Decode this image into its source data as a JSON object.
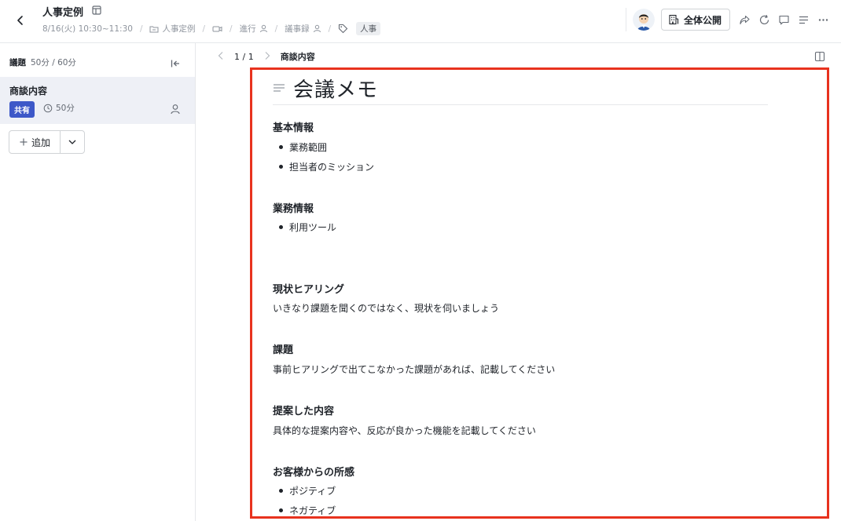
{
  "header": {
    "title": "人事定例",
    "datetime": "8/16(火) 10:30~11:30",
    "folder": "人事定例",
    "roles": [
      {
        "label": "進行"
      },
      {
        "label": "議事録"
      }
    ],
    "tag": "人事",
    "public_label": "全体公開"
  },
  "sidebar": {
    "heading": "議題",
    "time_total": "50分 / 60分",
    "topic": {
      "title": "商談内容",
      "badge": "共有",
      "duration": "50分"
    },
    "add_label": "追加"
  },
  "pager": {
    "position": "1 / 1",
    "topic_name": "商談内容"
  },
  "document": {
    "title": "会議メモ",
    "sections": [
      {
        "heading": "基本情報",
        "bullets": [
          "業務範囲",
          "担当者のミッション"
        ]
      },
      {
        "heading": "業務情報",
        "bullets": [
          "利用ツール"
        ]
      },
      {
        "heading": "現状ヒアリング",
        "text": "いきなり課題を聞くのではなく、現状を伺いましょう"
      },
      {
        "heading": "課題",
        "text": "事前ヒアリングで出てこなかった課題があれば、記載してください"
      },
      {
        "heading": "提案した内容",
        "text": "具体的な提案内容や、反応が良かった機能を記載してください"
      },
      {
        "heading": "お客様からの所感",
        "bullets": [
          "ポジティブ",
          "ネガティブ"
        ]
      }
    ]
  },
  "colors": {
    "accent": "#3d58c8",
    "highlight_border": "#e8321e",
    "sidebar_selected": "#eef0f6"
  }
}
